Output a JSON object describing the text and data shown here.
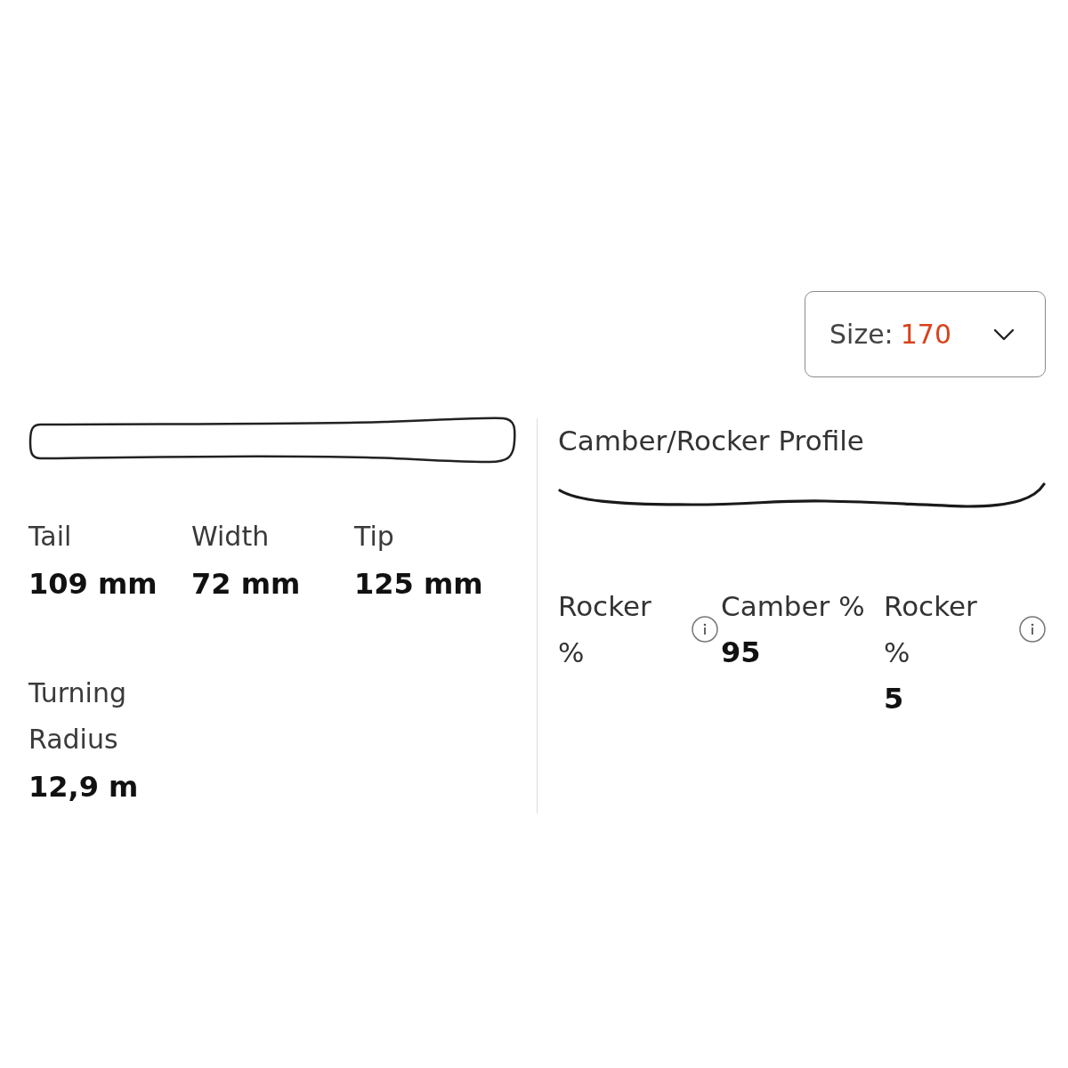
{
  "size_selector": {
    "label": "Size:",
    "value": "170"
  },
  "dimensions": {
    "specs": [
      {
        "label": "Tail",
        "value": "109 mm"
      },
      {
        "label": "Width",
        "value": "72 mm"
      },
      {
        "label": "Tip",
        "value": "125 mm"
      },
      {
        "label": "Turning Radius",
        "value": "12,9 m"
      }
    ]
  },
  "profile": {
    "title": "Camber/Rocker Profile",
    "stats": [
      {
        "label": "Rocker %",
        "info": true
      },
      {
        "label": "Camber %",
        "value": "95",
        "info": false
      },
      {
        "label": "Rocker %",
        "value": "5",
        "info": true
      }
    ]
  }
}
